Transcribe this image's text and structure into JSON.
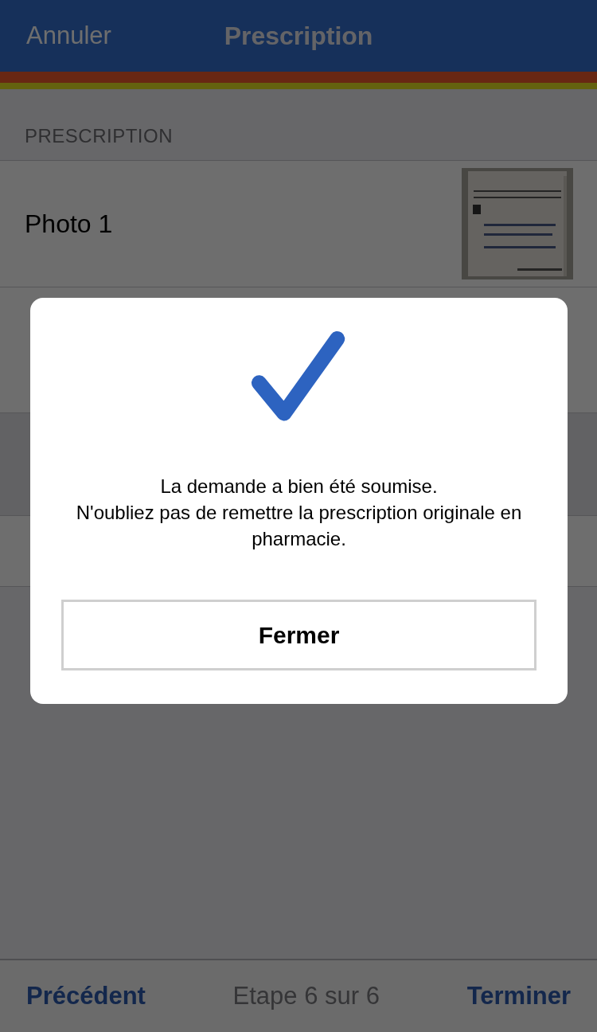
{
  "nav": {
    "cancel": "Annuler",
    "title": "Prescription"
  },
  "section_header": "PRESCRIPTION",
  "rows": [
    {
      "label": "Photo 1"
    }
  ],
  "modal": {
    "message": [
      "La demande a bien été soumise.",
      "N'oubliez pas de remettre la prescription originale en pharmacie."
    ],
    "button": "Fermer"
  },
  "bottom_bar": {
    "previous": "Précédent",
    "step": "Etape 6 sur 6",
    "finish": "Terminer"
  }
}
